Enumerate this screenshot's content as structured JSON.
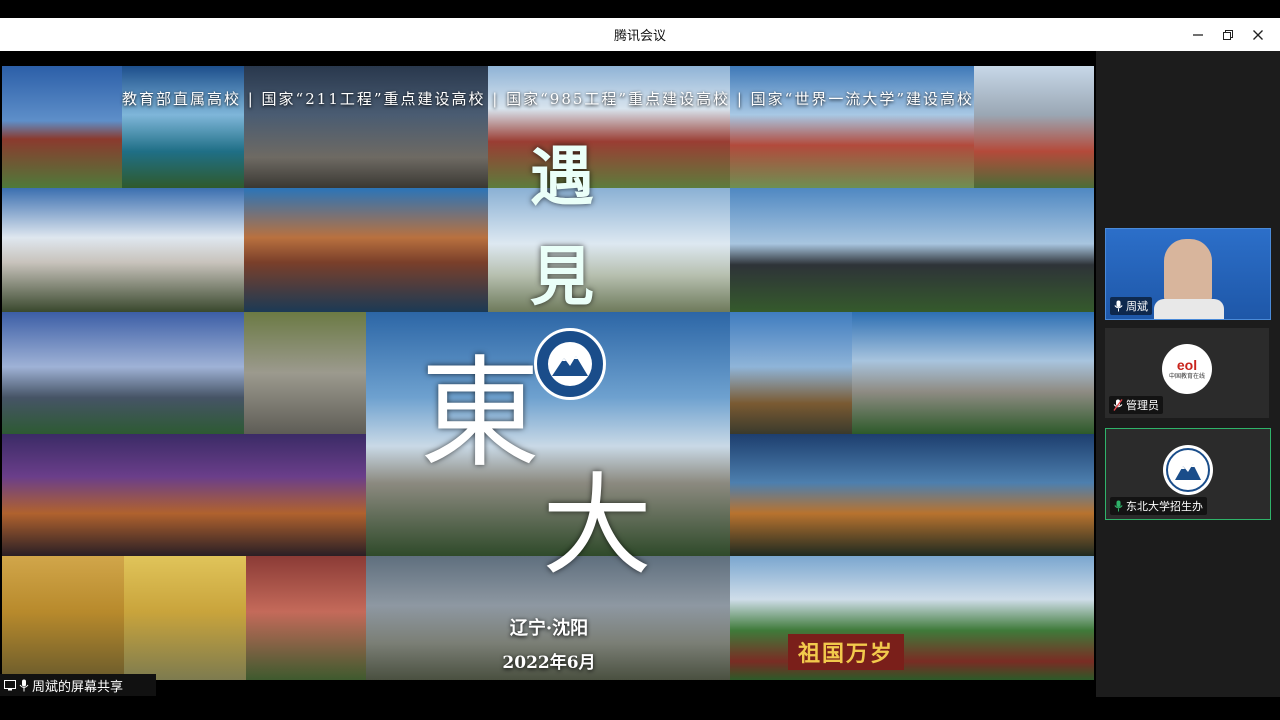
{
  "window": {
    "title": "腾讯会议"
  },
  "window_controls": {
    "minimize": "—",
    "restore": "❐",
    "close": "✕"
  },
  "slide": {
    "banner": "教育部直属高校 | 国家“211工程”重点建设高校 | 国家“985工程”重点建设高校  |  国家“世界一流大学”建设高校",
    "callig_1": "遇",
    "callig_2": "見",
    "callig_3": "東",
    "callig_4": "大",
    "location": "辽宁·沈阳",
    "date": "2022年6月",
    "slogan": "祖国万岁"
  },
  "share_status": {
    "label": "周斌的屏幕共享"
  },
  "participants": [
    {
      "name": "周斌",
      "mic": "on"
    },
    {
      "name": "管理员",
      "mic": "muted",
      "logo_text": "中国教育在线"
    },
    {
      "name": "东北大学招生办",
      "mic": "speaking"
    }
  ],
  "colors": {
    "speaking_border": "#2fb36a",
    "titlebar": "#ffffff",
    "sidebar": "#1c1c1c"
  }
}
